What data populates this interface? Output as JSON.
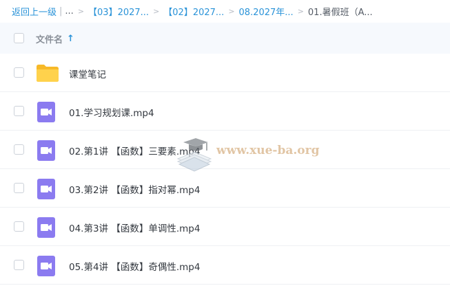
{
  "breadcrumb": {
    "back": "返回上一级",
    "pipe": "|",
    "ellipsis": "...",
    "items": [
      "【03】2027...",
      "【02】2027...",
      "08.2027年..."
    ],
    "current": "01.暑假班（A..."
  },
  "header": {
    "column_label": "文件名",
    "sort_icon": "arrow-up-icon"
  },
  "rows": [
    {
      "name": "课堂笔记",
      "type": "folder"
    },
    {
      "name": "01.学习规划课.mp4",
      "type": "video"
    },
    {
      "name": "02.第1讲 【函数】三要素.mp4",
      "type": "video"
    },
    {
      "name": "03.第2讲 【函数】指对幂.mp4",
      "type": "video"
    },
    {
      "name": "04.第3讲 【函数】单调性.mp4",
      "type": "video"
    },
    {
      "name": "05.第4讲 【函数】奇偶性.mp4",
      "type": "video"
    }
  ],
  "watermark": {
    "text": "www.xue-ba.org"
  },
  "colors": {
    "link": "#2a93d8",
    "video_icon": "#8b7bf0",
    "folder": "#ffcf4a",
    "header_bg": "#f6f9fd"
  }
}
